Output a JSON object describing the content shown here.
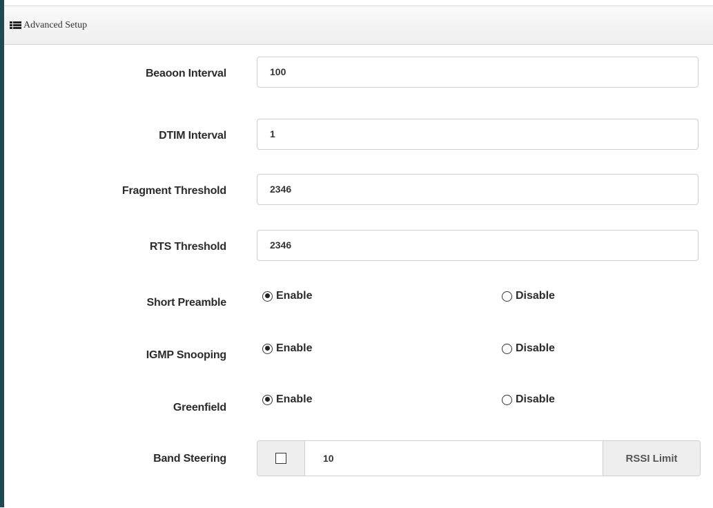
{
  "panel": {
    "title": "Advanced Setup",
    "icon": "list-icon"
  },
  "fields": {
    "beacon_interval": {
      "label": "Beaoon Interval",
      "value": "100"
    },
    "dtim_interval": {
      "label": "DTIM Interval",
      "value": "1"
    },
    "fragment_threshold": {
      "label": "Fragment Threshold",
      "value": "2346"
    },
    "rts_threshold": {
      "label": "RTS Threshold",
      "value": "2346"
    }
  },
  "radios": {
    "short_preamble": {
      "label": "Short Preamble",
      "enable": "Enable",
      "disable": "Disable",
      "selected": "Enable"
    },
    "igmp_snooping": {
      "label": "IGMP Snooping",
      "enable": "Enable",
      "disable": "Disable",
      "selected": "Enable"
    },
    "greenfield": {
      "label": "Greenfield",
      "enable": "Enable",
      "disable": "Disable",
      "selected": "Enable"
    }
  },
  "band_steering": {
    "label": "Band Steering",
    "checked": false,
    "value": "10",
    "addon": "RSSI Limit"
  }
}
